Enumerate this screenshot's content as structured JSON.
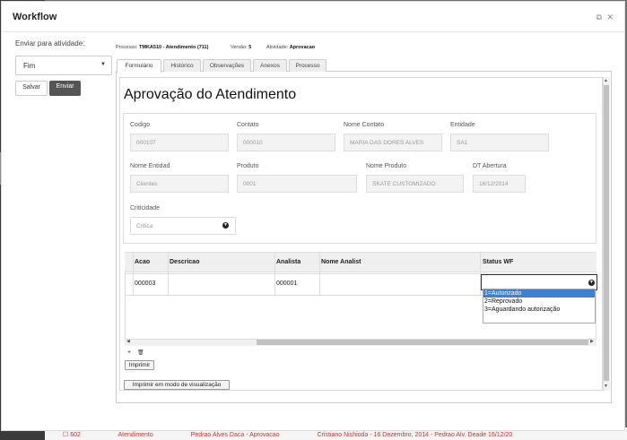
{
  "window": {
    "title": "Workflow",
    "icons": [
      "popout-icon",
      "close-icon"
    ]
  },
  "sidebar": {
    "label": "Enviar para atividade:",
    "select_value": "Fim",
    "save_label": "Salvar",
    "send_label": "Enviar"
  },
  "meta": {
    "processo_label": "Processo:",
    "processo_value": "TMKA510 - Atendimento (711)",
    "versao_label": "Versão:",
    "versao_value": "5",
    "atividade_label": "Atividade:",
    "atividade_value": "Aprovacao"
  },
  "tabs": [
    "Formulário",
    "Histórico",
    "Observações",
    "Anexos",
    "Processo"
  ],
  "form": {
    "title": "Aprovação do Atendimento",
    "fields": {
      "codigo": {
        "label": "Codigo",
        "value": "000107"
      },
      "contato": {
        "label": "Contato",
        "value": "000010"
      },
      "nome_contato": {
        "label": "Nome Contato",
        "value": "MARIA DAS DORES ALVES"
      },
      "entidade": {
        "label": "Entidade",
        "value": "SA1"
      },
      "nome_entidad": {
        "label": "Nome Entidad",
        "value": "Clientes"
      },
      "produto": {
        "label": "Produto",
        "value": "0001"
      },
      "nome_produto": {
        "label": "Nome Produto",
        "value": "SKATE CUSTOMIZADO"
      },
      "dt_abertura": {
        "label": "DT Abertura",
        "value": "16/12/2014"
      },
      "criticidade": {
        "label": "Criticidade",
        "value": "Critica"
      }
    }
  },
  "grid": {
    "columns": [
      "Acao",
      "Descricao",
      "Analista",
      "Nome Analist",
      "Status WF"
    ],
    "rows": [
      {
        "acao": "000003",
        "descricao": "",
        "analista": "000001",
        "nome_analist": "",
        "status": ""
      }
    ],
    "status_options": [
      "1=Autorizado",
      "2=Reprovado",
      "3=Aguardando autorização"
    ],
    "selected_option": "1=Autorizado"
  },
  "buttons": {
    "add": "+",
    "print": "Imprimir",
    "print_view": "Imprimir em modo de visualização"
  },
  "background_row": [
    "☐ 602",
    "Atendimento",
    "Pedrao Alves Daca - Aprovacao",
    "Cristiano Nishioda - 16 Dezembro, 2014 - Pedrao Alv. Deade 16/12/20"
  ]
}
